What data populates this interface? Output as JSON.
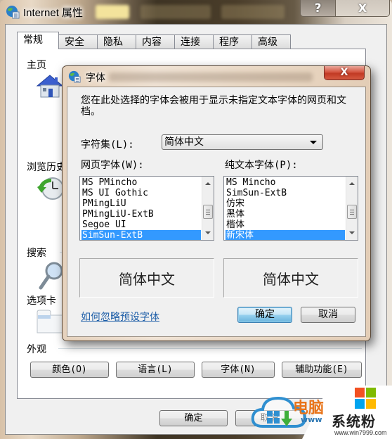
{
  "window": {
    "title": "Internet 属性",
    "help_label": "?",
    "close_label": "X"
  },
  "tabs": [
    {
      "label": "常规",
      "active": true
    },
    {
      "label": "安全",
      "active": false
    },
    {
      "label": "隐私",
      "active": false
    },
    {
      "label": "内容",
      "active": false
    },
    {
      "label": "连接",
      "active": false
    },
    {
      "label": "程序",
      "active": false
    },
    {
      "label": "高级",
      "active": false
    }
  ],
  "general": {
    "home_label": "主页",
    "history_label": "浏览历史",
    "search_label": "搜索",
    "tabs_label": "选项卡",
    "appearance_label": "外观",
    "appearance_buttons": [
      "颜色(O)",
      "语言(L)",
      "字体(N)",
      "辅助功能(E)"
    ]
  },
  "footer": {
    "ok_label": "确定",
    "cancel_label": "取消"
  },
  "font_dialog": {
    "title": "字体",
    "close_label": "X",
    "description": "您在此处选择的字体会被用于显示未指定文本字体的网页和文档。",
    "charset_label": "字符集(L):",
    "charset_value": "简体中文",
    "webpage_font_label": "网页字体(W):",
    "plaintext_font_label": "纯文本字体(P):",
    "webpage_fonts": [
      "MS PMincho",
      "MS UI Gothic",
      "PMingLiU",
      "PMingLiU-ExtB",
      "Segoe UI",
      "SimSun-ExtB"
    ],
    "webpage_font_selected": "SimSun-ExtB",
    "plaintext_fonts": [
      "MS Mincho",
      "SimSun-ExtB",
      "仿宋",
      "黑体",
      "楷体",
      "新宋体"
    ],
    "plaintext_font_selected": "新宋体",
    "webpage_preview": "简体中文",
    "plaintext_preview": "简体中文",
    "help_link": "如何忽略预设字体",
    "ok_label": "确定",
    "cancel_label": "取消"
  },
  "watermark": {
    "text1": "电脑",
    "url_fragment": "www",
    "brand": "系统粉",
    "url": "www.win7999.com"
  },
  "colors": {
    "selection": "#3399ff",
    "link": "#1f5fa8",
    "close_red": "#c13a24",
    "default_button": "#68b3db"
  }
}
